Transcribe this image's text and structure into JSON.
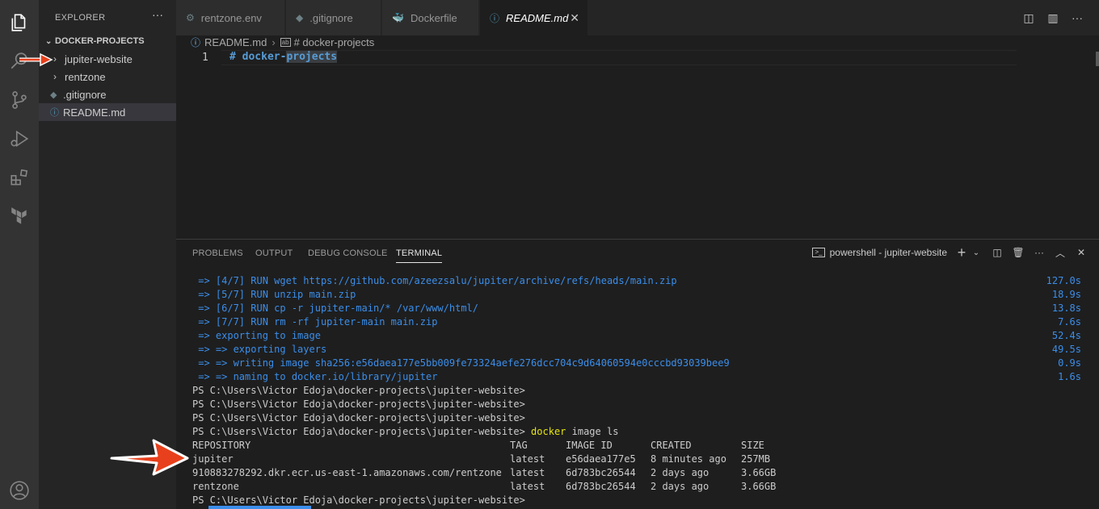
{
  "sidebar": {
    "title": "EXPLORER",
    "more": "···",
    "section": "DOCKER-PROJECTS",
    "items": [
      {
        "label": "jupiter-website",
        "type": "folder"
      },
      {
        "label": "rentzone",
        "type": "folder"
      },
      {
        "label": ".gitignore",
        "type": "file"
      },
      {
        "label": "README.md",
        "type": "file",
        "selected": true
      }
    ]
  },
  "tabs": [
    {
      "label": "rentzone.env",
      "icon": "gear-icon"
    },
    {
      "label": ".gitignore",
      "icon": "diamond-icon"
    },
    {
      "label": "Dockerfile",
      "icon": "docker-icon"
    },
    {
      "label": "README.md",
      "icon": "info-icon",
      "active": true,
      "close": "✕"
    }
  ],
  "breadcrumb": {
    "file": "README.md",
    "symbol": "# docker-projects"
  },
  "editor": {
    "line_number": "1",
    "code_prefix": "# docker-",
    "code_selected": "projects"
  },
  "panel": {
    "tabs": [
      "PROBLEMS",
      "OUTPUT",
      "DEBUG CONSOLE",
      "TERMINAL"
    ],
    "active_tab": "TERMINAL",
    "shell": "powershell - jupiter-website"
  },
  "terminal": {
    "build_lines": [
      {
        "text": " => [4/7] RUN wget https://github.com/azeezsalu/jupiter/archive/refs/heads/main.zip",
        "time": "127.0s"
      },
      {
        "text": " => [5/7] RUN unzip main.zip",
        "time": "18.9s"
      },
      {
        "text": " => [6/7] RUN cp -r jupiter-main/* /var/www/html/",
        "time": "13.8s"
      },
      {
        "text": " => [7/7] RUN rm -rf jupiter-main main.zip",
        "time": "7.6s"
      },
      {
        "text": " => exporting to image",
        "time": "52.4s"
      },
      {
        "text": " => => exporting layers",
        "time": "49.5s"
      },
      {
        "text": " => => writing image sha256:e56daea177e5bb009fe73324aefe276dcc704c9d64060594e0cccbd93039bee9",
        "time": "0.9s"
      },
      {
        "text": " => => naming to docker.io/library/jupiter",
        "time": "1.6s"
      }
    ],
    "prompt": "PS C:\\Users\\Victor Edoja\\docker-projects\\jupiter-website>",
    "command": "docker image ls",
    "command_cmd": "docker",
    "command_args": " image ls",
    "table_headers": [
      "REPOSITORY",
      "TAG",
      "IMAGE ID",
      "CREATED",
      "SIZE"
    ],
    "table_rows": [
      [
        "jupiter",
        "latest",
        "e56daea177e5",
        "8 minutes ago",
        "257MB"
      ],
      [
        "910883278292.dkr.ecr.us-east-1.amazonaws.com/rentzone",
        "latest",
        "6d783bc26544",
        "2 days ago",
        "3.66GB"
      ],
      [
        "rentzone",
        "latest",
        "6d783bc26544",
        "2 days ago",
        "3.66GB"
      ]
    ]
  },
  "colors": {
    "accent_blue": "#3b8eea",
    "arrow_red": "#e8401c"
  }
}
